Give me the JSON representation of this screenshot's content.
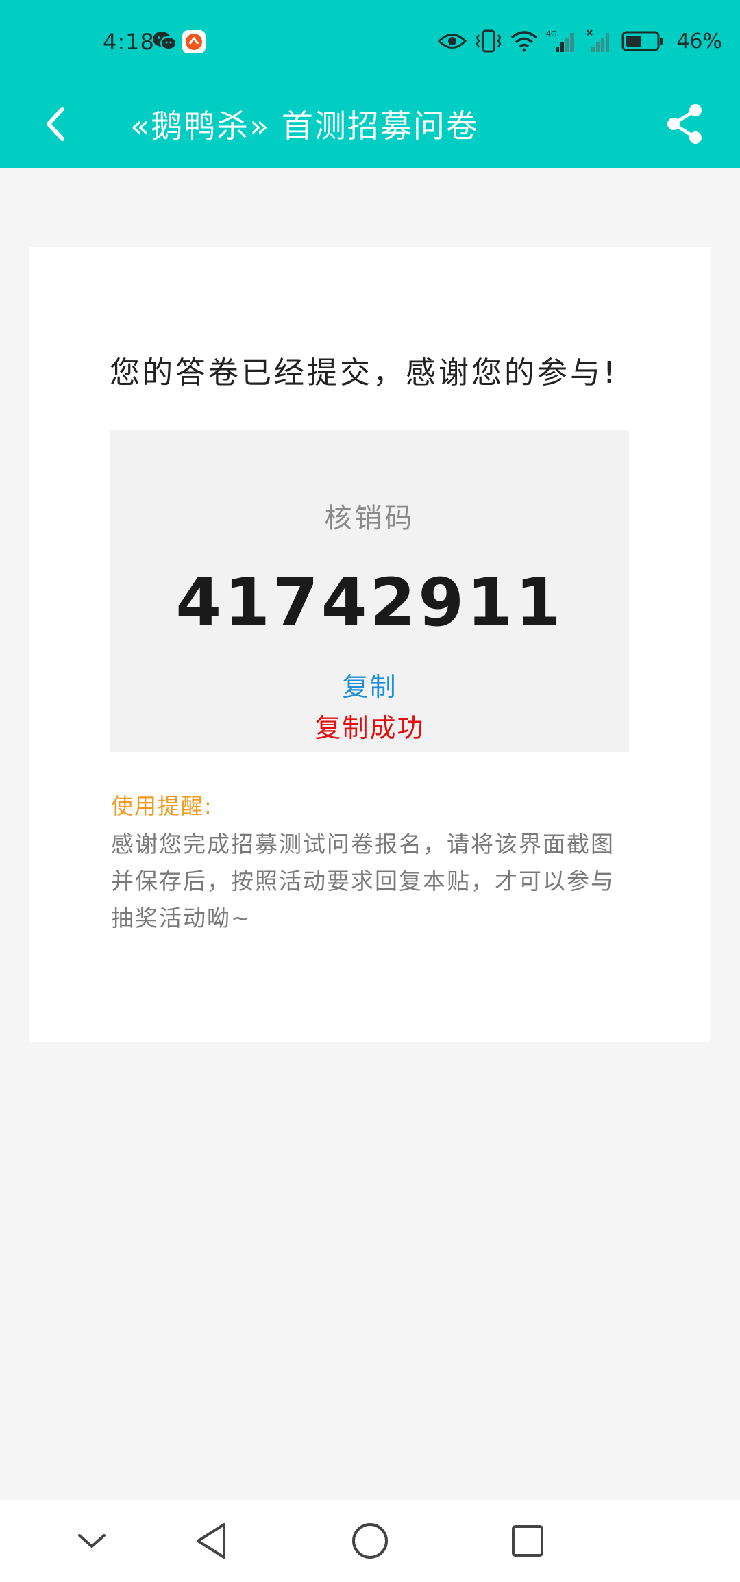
{
  "status_bar": {
    "time": "4:18",
    "battery": "46%",
    "network": "4G",
    "icons": [
      "wechat-icon",
      "app-notification-icon",
      "eye-icon",
      "vibrate-icon",
      "wifi-icon",
      "signal-icon",
      "signal-no-service-icon",
      "battery-icon"
    ]
  },
  "header": {
    "title": "«鹅鸭杀» 首测招募问卷",
    "back_icon": "chevron-left-icon",
    "share_icon": "share-icon",
    "background_color": "#00cec3"
  },
  "card": {
    "success_message": "您的答卷已经提交，感谢您的参与!",
    "code_label": "核销码",
    "code_value": "41742911",
    "copy_label": "复制",
    "copy_success": "复制成功",
    "reminder_title": "使用提醒:",
    "reminder_text": "感谢您完成招募测试问卷报名，请将该界面截图并保存后，按照活动要求回复本贴，才可以参与抽奖活动呦~"
  },
  "colors": {
    "accent": "#00cec3",
    "copy_link": "#1c8fd8",
    "copy_success": "#e30e0e",
    "reminder_title": "#f39a1f"
  },
  "nav_bar": {
    "icons": [
      "chevron-down-icon",
      "back-triangle-icon",
      "home-circle-icon",
      "recent-apps-square-icon"
    ]
  }
}
